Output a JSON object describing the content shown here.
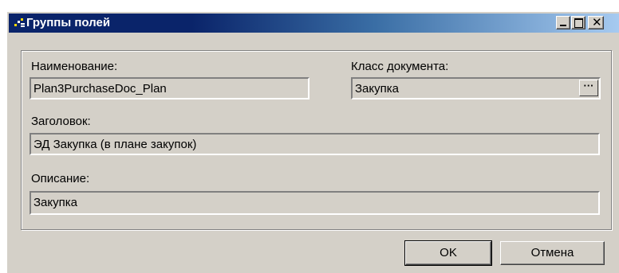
{
  "window": {
    "title": "Группы полей",
    "icon": "field-groups-icon"
  },
  "form": {
    "name_label": "Наименование:",
    "name_value": "Plan3PurchaseDoc_Plan",
    "doc_class_label": "Класс документа:",
    "doc_class_value": "Закупка",
    "ellipsis_label": "···",
    "header_label": "Заголовок:",
    "header_value": "ЭД Закупка (в плане закупок)",
    "description_label": "Описание:",
    "description_value": "Закупка"
  },
  "buttons": {
    "ok_label": "OK",
    "cancel_label": "Отмена"
  },
  "colors": {
    "titlebar_start": "#0a246a",
    "titlebar_end": "#a6caf0",
    "face": "#d4d0c8"
  }
}
